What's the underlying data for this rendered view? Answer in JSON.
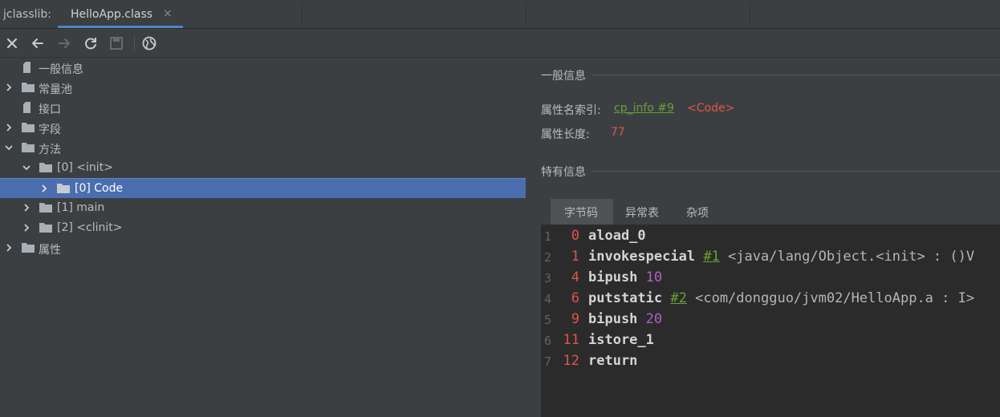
{
  "tabbar": {
    "tool_label": "jclasslib:",
    "tab_title": "HelloApp.class",
    "tab_close": "×"
  },
  "toolbar": {
    "buttons": [
      "close-icon",
      "back-arrow-icon",
      "forward-arrow-icon",
      "refresh-icon",
      "save-icon",
      "web-icon"
    ]
  },
  "tree": {
    "items": [
      {
        "label": "一般信息",
        "icon": "file-icon",
        "expanded": null
      },
      {
        "label": "常量池",
        "icon": "folder-icon",
        "expanded": false
      },
      {
        "label": "接口",
        "icon": "file-icon",
        "expanded": null
      },
      {
        "label": "字段",
        "icon": "folder-icon",
        "expanded": false
      },
      {
        "label": "方法",
        "icon": "folder-icon",
        "expanded": true
      },
      {
        "label": "[0] <init>",
        "icon": "folder-icon",
        "expanded": true
      },
      {
        "label": "[0] Code",
        "icon": "folder-icon",
        "expanded": false,
        "selected": true
      },
      {
        "label": "[1] main",
        "icon": "folder-icon",
        "expanded": false
      },
      {
        "label": "[2] <clinit>",
        "icon": "folder-icon",
        "expanded": false
      },
      {
        "label": "属性",
        "icon": "folder-icon",
        "expanded": false
      }
    ]
  },
  "detail": {
    "general_title": "一般信息",
    "attr_name_index_label": "属性名索引:",
    "attr_name_index_link": "cp_info #9",
    "attr_name_index_value": "<Code>",
    "attr_length_label": "属性长度:",
    "attr_length_value": "77",
    "specific_title": "特有信息",
    "subtabs": [
      "字节码",
      "异常表",
      "杂项"
    ],
    "active_subtab": "字节码"
  },
  "bytecode": [
    {
      "line": "1",
      "offset": "0",
      "op": "aload_0",
      "ref": "",
      "arg": "",
      "num": ""
    },
    {
      "line": "2",
      "offset": "1",
      "op": "invokespecial",
      "ref": "#1",
      "arg": "<java/lang/Object.<init> : ()V",
      "num": ""
    },
    {
      "line": "3",
      "offset": "4",
      "op": "bipush",
      "ref": "",
      "arg": "",
      "num": "10"
    },
    {
      "line": "4",
      "offset": "6",
      "op": "putstatic",
      "ref": "#2",
      "arg": "<com/dongguo/jvm02/HelloApp.a : I>",
      "num": ""
    },
    {
      "line": "5",
      "offset": "9",
      "op": "bipush",
      "ref": "",
      "arg": "",
      "num": "20"
    },
    {
      "line": "6",
      "offset": "11",
      "op": "istore_1",
      "ref": "",
      "arg": "",
      "num": ""
    },
    {
      "line": "7",
      "offset": "12",
      "op": "return",
      "ref": "",
      "arg": "",
      "num": ""
    }
  ],
  "colors": {
    "accent": "#4a88c7",
    "selection": "#4b6eaf",
    "link": "#6a9f3a",
    "value_red": "#e0544b",
    "number_purple": "#b05fc7"
  }
}
